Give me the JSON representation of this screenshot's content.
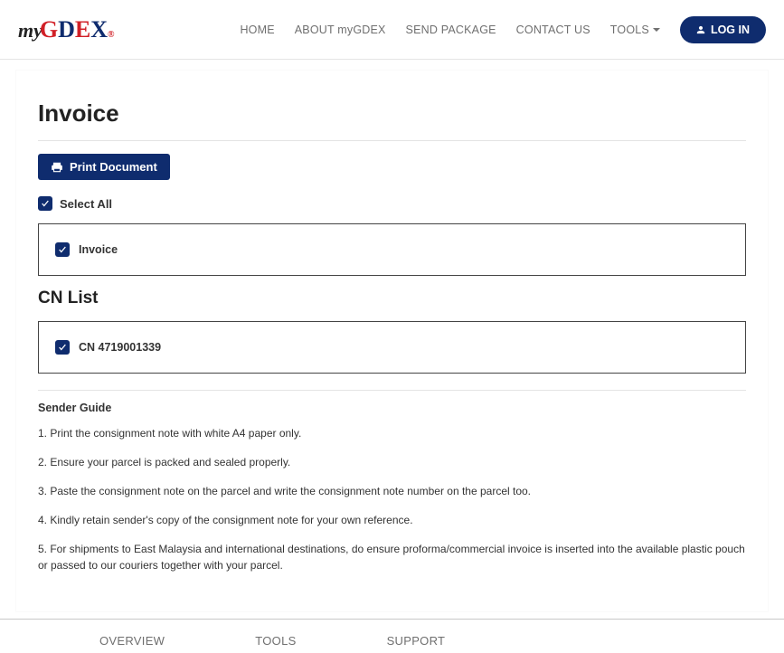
{
  "nav": {
    "home": "HOME",
    "about": "ABOUT myGDEX",
    "send": "SEND PACKAGE",
    "contact": "CONTACT US",
    "tools": "TOOLS",
    "login": "LOG IN"
  },
  "logo": {
    "my": "my",
    "g": "G",
    "d": "D",
    "e": "E",
    "x": "X"
  },
  "page": {
    "title": "Invoice",
    "print_label": "Print Document",
    "select_all_label": "Select All",
    "invoice_item_label": "Invoice",
    "cn_section_title": "CN List",
    "cn_item_label": "CN 4719001339"
  },
  "guide": {
    "title": "Sender Guide",
    "lines": [
      "1. Print the consignment note with white A4 paper only.",
      "2. Ensure your parcel is packed and sealed properly.",
      "3. Paste the consignment note on the parcel and write the consignment note number on the parcel too.",
      "4. Kindly retain sender's copy of the consignment note for your own reference.",
      "5. For shipments to East Malaysia and international destinations, do ensure proforma/commercial invoice is inserted into the available plastic pouch or passed to our couriers together with your parcel."
    ]
  },
  "footer": {
    "overview": "OVERVIEW",
    "tools": "TOOLS",
    "support": "SUPPORT"
  }
}
